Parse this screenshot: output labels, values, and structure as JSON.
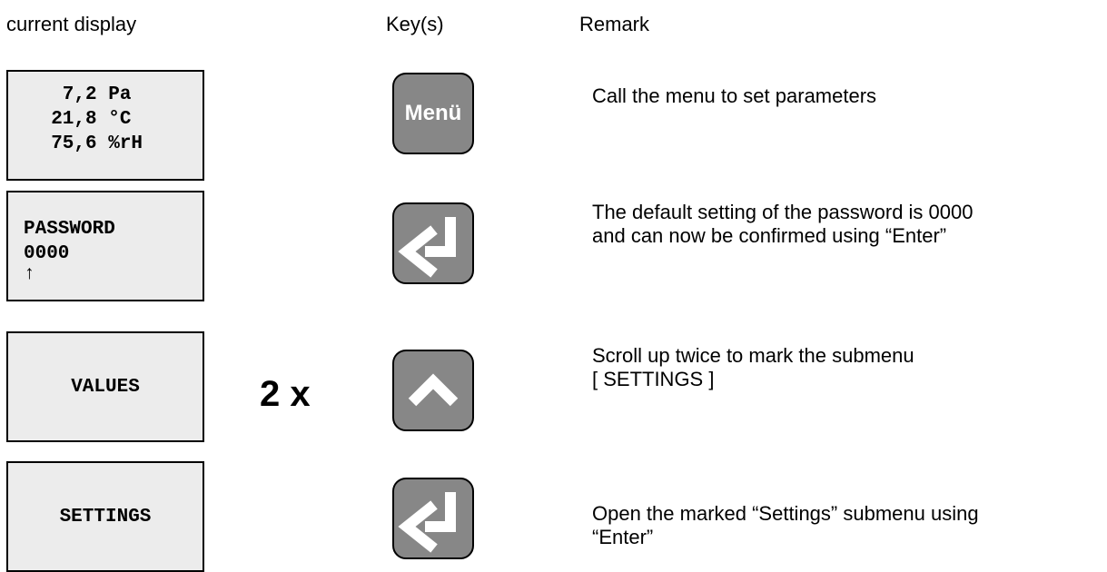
{
  "headers": {
    "display": "current display",
    "keys": "Key(s)",
    "remark": "Remark"
  },
  "rows": [
    {
      "display_lines": [
        "   7,2 Pa",
        "  21,8 °C",
        "  75,6 %rH"
      ],
      "key": {
        "label": "Menü",
        "icon": "menu-key"
      },
      "remark_lines": [
        "Call the menu to set parameters"
      ]
    },
    {
      "display_lines": [
        "PASSWORD",
        "0000",
        "↑"
      ],
      "key": {
        "icon": "enter-icon"
      },
      "remark_lines": [
        "The default setting of the password is 0000",
        "and can now be confirmed using “Enter”"
      ]
    },
    {
      "display_lines": [
        "VALUES"
      ],
      "multiplier": "2 x",
      "key": {
        "icon": "arrow-up-icon"
      },
      "remark_lines": [
        "Scroll up twice to mark the submenu",
        "[ SETTINGS ]"
      ]
    },
    {
      "display_lines": [
        "SETTINGS"
      ],
      "key": {
        "icon": "enter-icon"
      },
      "remark_lines": [
        "Open the marked “Settings” submenu using",
        "“Enter”"
      ]
    }
  ],
  "colors": {
    "lcd_background": "#ececec",
    "key_background": "#878787",
    "key_symbol": "#ffffff"
  }
}
